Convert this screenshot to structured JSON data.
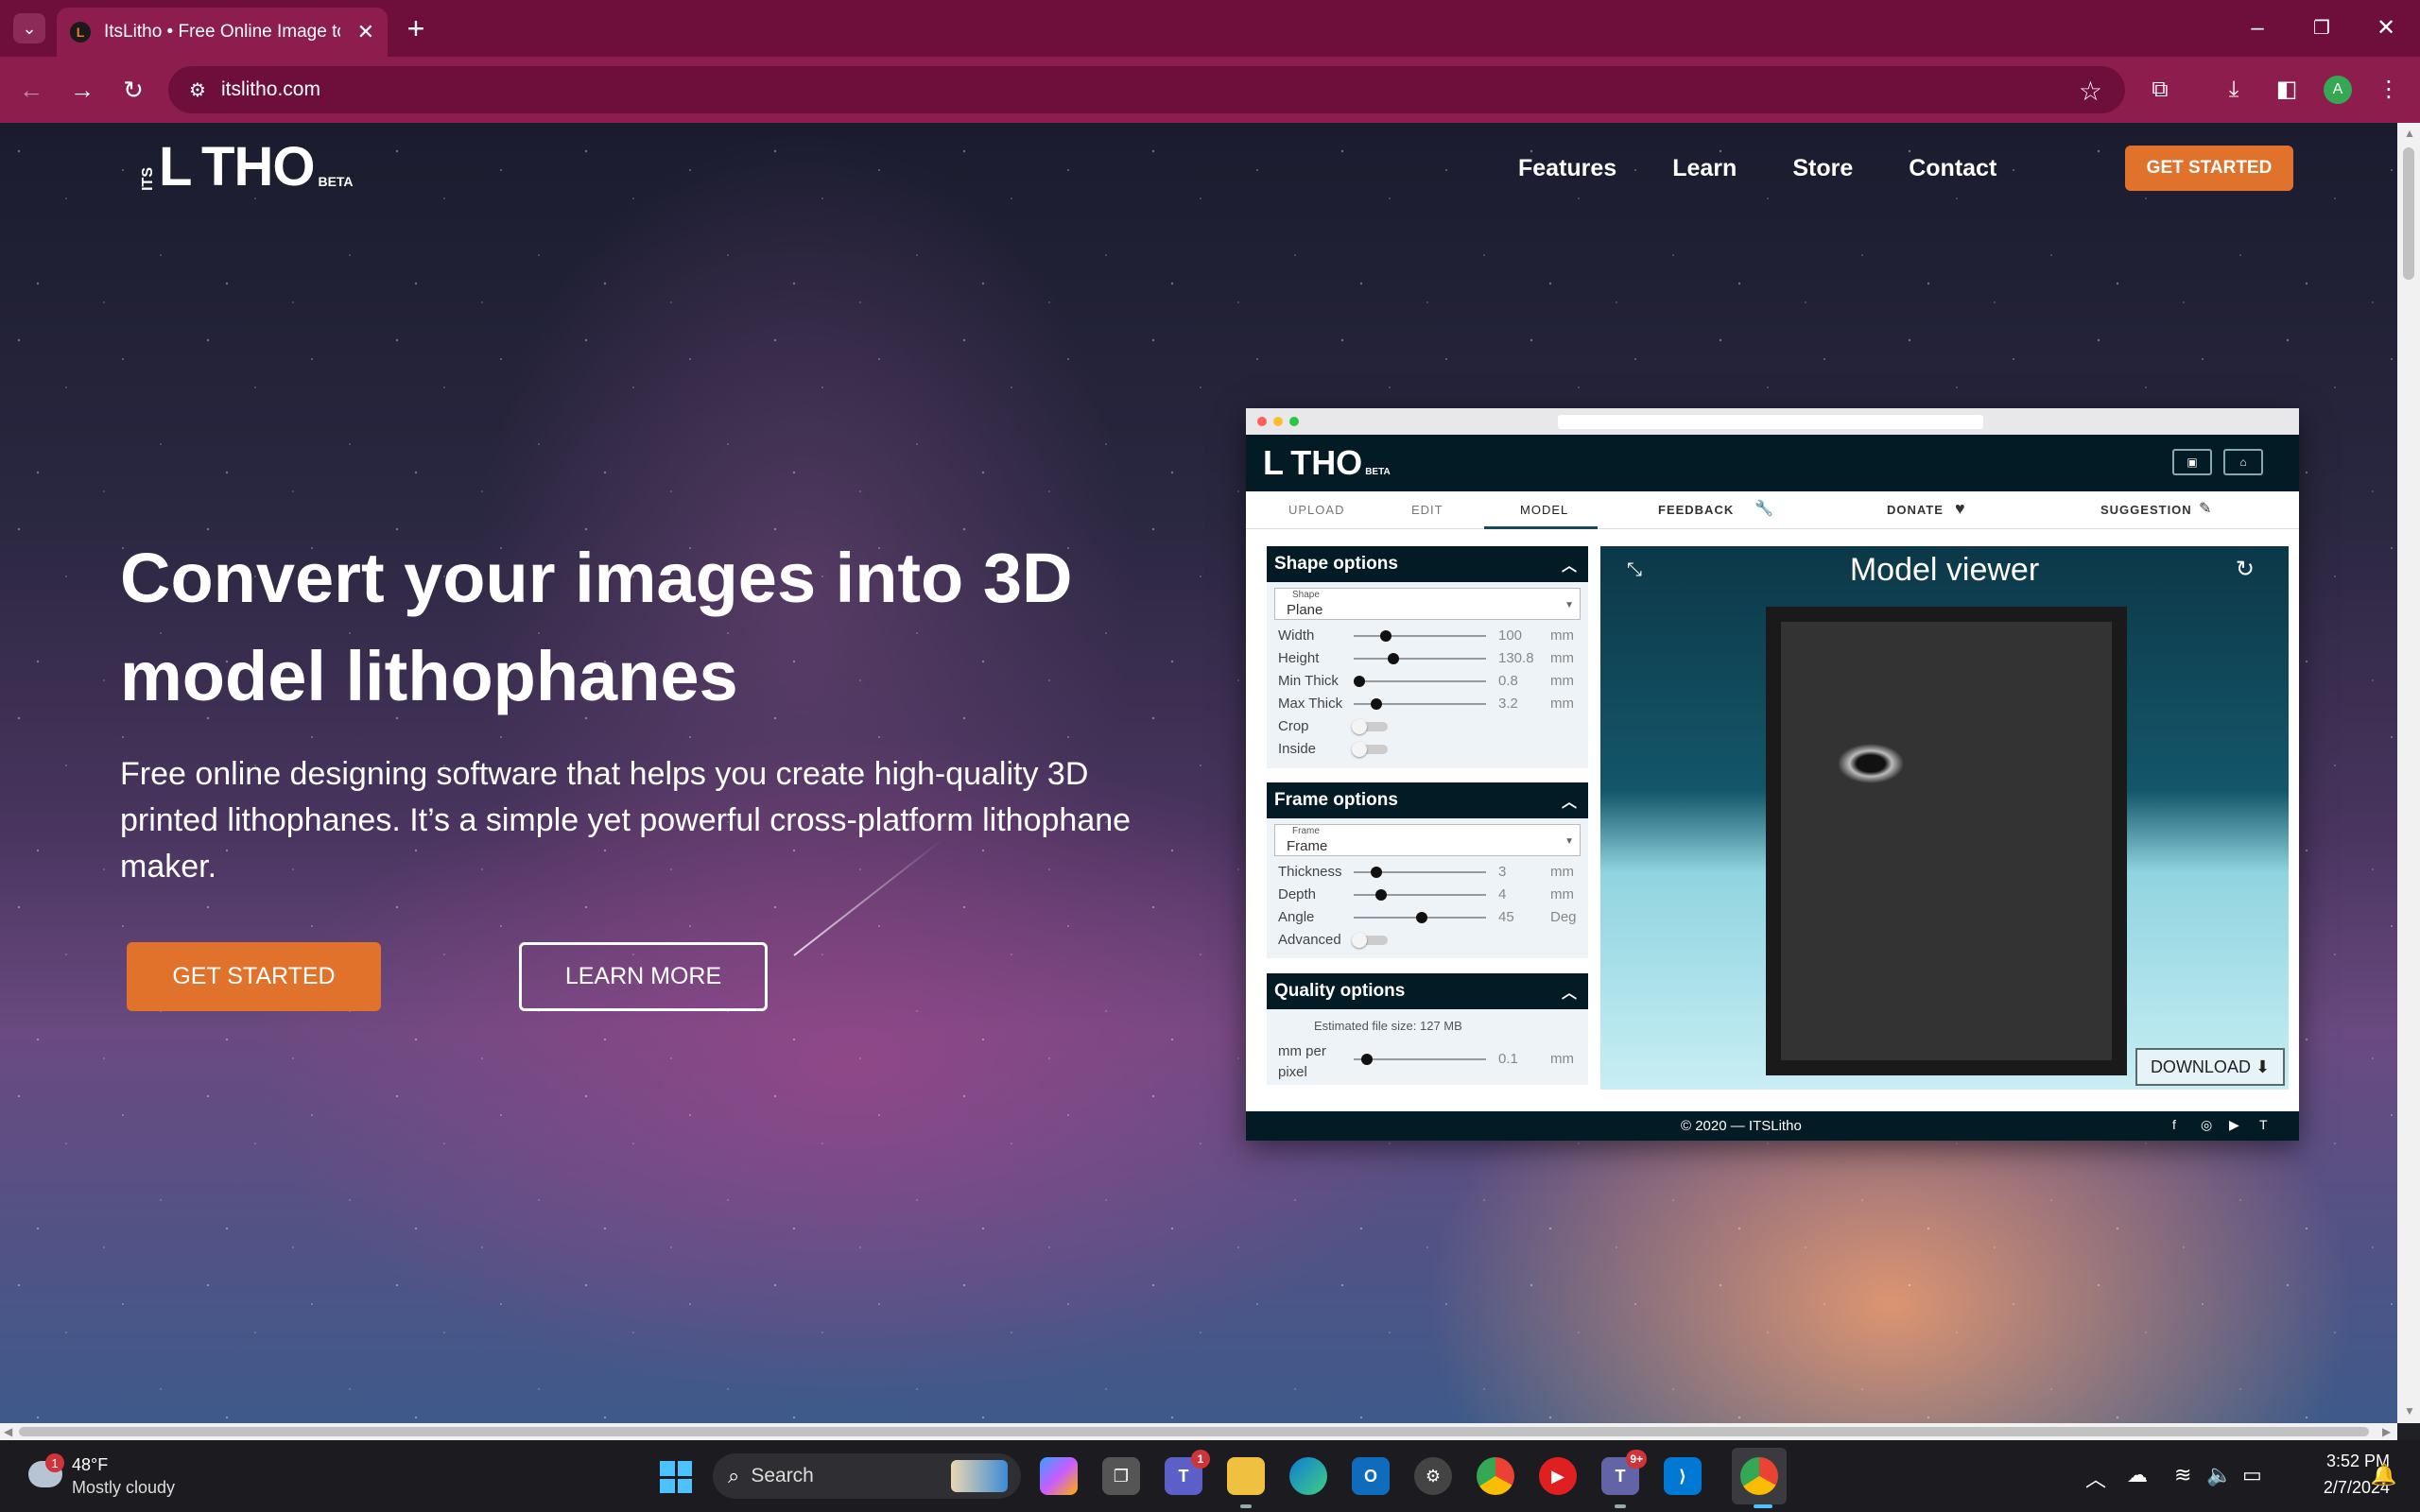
{
  "browser": {
    "tab_title": "ItsLitho • Free Online Image to Lithophane",
    "url": "itslitho.com",
    "profile_initial": "A"
  },
  "site": {
    "logo_its": "ITS",
    "logo_main": "L THO",
    "logo_beta": "BETA",
    "nav": [
      "Features",
      "Learn",
      "Store",
      "Contact"
    ],
    "nav_cta": "GET STARTED",
    "hero_title": "Convert your images into 3D model lithophanes",
    "hero_subtitle": "Free online designing software that helps you create high-quality 3D printed lithophanes. It’s a simple yet powerful cross-platform lithophane maker.",
    "btn_get_started": "GET STARTED",
    "btn_learn_more": "LEARN MORE",
    "accent_color": "#e0722c"
  },
  "mockup": {
    "logo": "L THO",
    "logo_beta": "BETA",
    "tabs": {
      "upload": "UPLOAD",
      "edit": "EDIT",
      "model": "MODEL",
      "feedback": "FEEDBACK",
      "donate": "DONATE",
      "suggestion": "SUGGESTION"
    },
    "shape": {
      "title": "Shape options",
      "select_label": "Shape",
      "select_value": "Plane",
      "rows": [
        {
          "label": "Width",
          "value": "100",
          "unit": "mm"
        },
        {
          "label": "Height",
          "value": "130.8",
          "unit": "mm"
        },
        {
          "label": "Min Thick",
          "value": "0.8",
          "unit": "mm"
        },
        {
          "label": "Max Thick",
          "value": "3.2",
          "unit": "mm"
        }
      ],
      "toggles": [
        "Crop",
        "Inside"
      ]
    },
    "frame": {
      "title": "Frame options",
      "select_label": "Frame",
      "select_value": "Frame",
      "rows": [
        {
          "label": "Thickness",
          "value": "3",
          "unit": "mm"
        },
        {
          "label": "Depth",
          "value": "4",
          "unit": "mm"
        },
        {
          "label": "Angle",
          "value": "45",
          "unit": "Deg"
        }
      ],
      "toggle": "Advanced"
    },
    "quality": {
      "title": "Quality options",
      "estimate": "Estimated file size: 127 MB",
      "row_label_1": "mm per",
      "row_label_2": "pixel",
      "value": "0.1",
      "unit": "mm"
    },
    "viewer": {
      "title": "Model viewer",
      "download": "DOWNLOAD"
    },
    "footer": "© 2020 — ITSLitho"
  },
  "taskbar": {
    "weather_badge": "1",
    "temperature": "48°F",
    "weather": "Mostly cloudy",
    "search": "Search",
    "teams_badge": "1",
    "chat_badge": "9+",
    "time": "3:52 PM",
    "date": "2/7/2024"
  }
}
